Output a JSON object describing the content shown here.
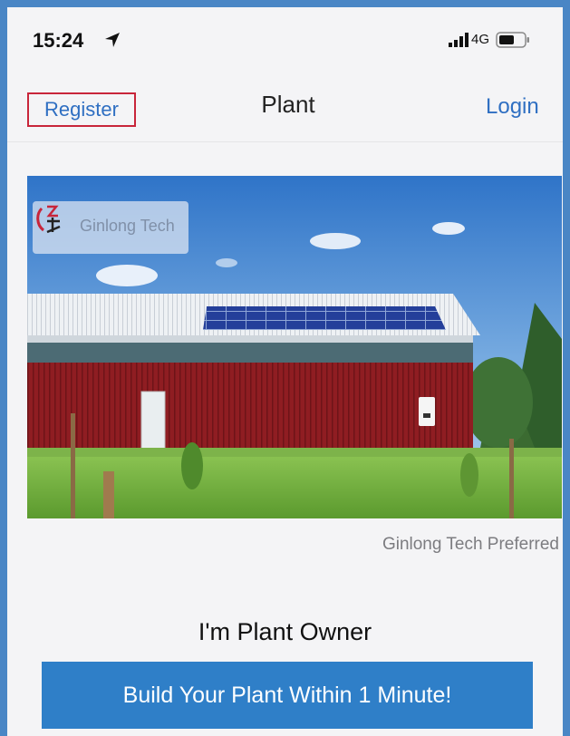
{
  "status_bar": {
    "time": "15:24",
    "network": "4G",
    "icons": [
      "location-arrow-icon",
      "signal-bars-icon",
      "battery-icon"
    ]
  },
  "nav": {
    "register_label": "Register",
    "title": "Plant",
    "login_label": "Login"
  },
  "hero": {
    "brand_name": "Ginlong Tech",
    "caption": "Ginlong Tech Preferred"
  },
  "owner_heading": "I'm Plant Owner",
  "cta_label": "Build Your Plant Within 1 Minute!",
  "colors": {
    "accent": "#2f7fc8",
    "link": "#2f6fc2",
    "register_highlight": "#c8253a",
    "frame": "#4a86c5"
  }
}
